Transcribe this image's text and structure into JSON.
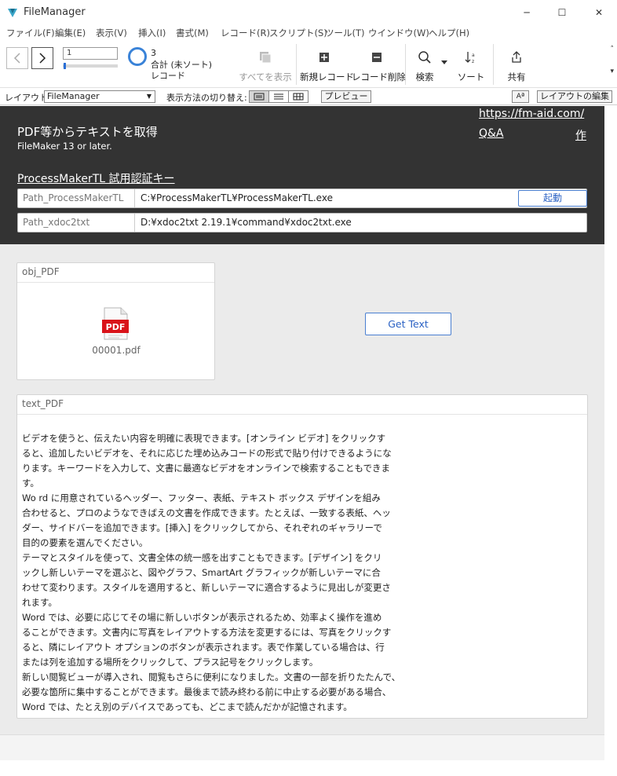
{
  "window": {
    "title": "FileManager",
    "minimize_glyph": "─",
    "maximize_glyph": "☐",
    "close_glyph": "✕"
  },
  "menu": {
    "items": [
      "ファイル(F)",
      "編集(E)",
      "表示(V)",
      "挿入(I)",
      "書式(M)",
      "レコード(R)",
      "スクリプト(S)",
      "ツール(T)",
      "ウインドウ(W)",
      "ヘルプ(H)"
    ]
  },
  "toolbar": {
    "record_number": "1",
    "found_count": "3",
    "found_label": "合計 (未ソート)",
    "found_unit": "レコード",
    "show_all_label": "すべてを表示",
    "new_record_label": "新規レコード",
    "delete_record_label": "レコード削除",
    "find_label": "検索",
    "sort_label": "ソート",
    "share_label": "共有",
    "scroll_up_glyph": "˄",
    "scroll_down_glyph": "▾"
  },
  "layout_bar": {
    "layout_label": "レイアウト:",
    "layout_value": "FileManager",
    "view_as_label": "表示方法の切り替え:",
    "preview_label": "プレビュー",
    "font_button_label": "Aª",
    "edit_layout_label": "レイアウトの編集"
  },
  "header": {
    "title": "PDF等からテキストを取得",
    "subtitle": "FileMaker 13 or later.",
    "link_url": "https://fm-aid.com/",
    "link_qa": "Q&A",
    "link_author": "作",
    "trial_key": "ProcessMakerTL 試用認証キー"
  },
  "fields": {
    "path_pm_label": "Path_ProcessMakerTL",
    "path_pm_value": "C:¥ProcessMakerTL¥ProcessMakerTL.exe",
    "launch_label": "起動",
    "path_xdoc_label": "Path_xdoc2txt",
    "path_xdoc_value": "D:¥xdoc2txt 2.19.1¥command¥xdoc2txt.exe"
  },
  "obj_pdf": {
    "title": "obj_PDF",
    "filename": "00001.pdf",
    "icon_text": "PDF"
  },
  "get_text_label": "Get Text",
  "text_pdf": {
    "title": "text_PDF",
    "lines": [
      "ビデオを使うと、伝えたい内容を明確に表現できます。[オンライン ビデオ] をクリックす",
      "ると、追加したいビデオを、それに応じた埋め込みコードの形式で貼り付けできるようにな",
      "ります。キーワードを入力して、文書に最適なビデオをオンラインで検索することもできま",
      "す。",
      "Wo rd  に用意されているヘッダー、フッター、表紙、テキスト ボックス デザインを組み",
      "合わせると、プロのようなできばえの文書を作成できます。たとえば、一致する表紙、ヘッ",
      "ダー、サイドバーを追加できます。[挿入] をクリックしてから、それぞれのギャラリーで",
      "目的の要素を選んでください。",
      "テーマとスタイルを使って、文書全体の統一感を出すこともできます。[デザイン] をクリ",
      "ックし新しいテーマを選ぶと、図やグラフ、SmartArt  グラフィックが新しいテーマに合",
      "わせて変わります。スタイルを適用すると、新しいテーマに適合するように見出しが変更さ",
      "れます。",
      "Word  では、必要に応じてその場に新しいボタンが表示されるため、効率よく操作を進め",
      "ることができます。文書内に写真をレイアウトする方法を変更するには、写真をクリックす",
      "ると、隣にレイアウト オプションのボタンが表示されます。表で作業している場合は、行",
      "または列を追加する場所をクリックして、プラス記号をクリックします。",
      "新しい閲覧ビューが導入され、閲覧もさらに便利になりました。文書の一部を折りたたんで、",
      "必要な箇所に集中することができます。最後まで読み終わる前に中止する必要がある場合、",
      "Word  では、たとえ別のデバイスであっても、どこまで読んだかが記憶されます。"
    ]
  },
  "colors": {
    "header_bg": "#333333",
    "accent_blue": "#2b62c4",
    "pdf_red": "#d9131a"
  },
  "icons": {
    "app": "filemaker-icon",
    "prev": "chevron-left-icon",
    "next": "chevron-right-icon",
    "pie": "pie-chart-icon",
    "show_all": "records-stack-icon",
    "new_record": "plus-square-icon",
    "delete_record": "minus-square-icon",
    "find": "magnifier-icon",
    "sort": "sort-az-icon",
    "share": "share-icon",
    "pdf": "pdf-file-icon"
  }
}
